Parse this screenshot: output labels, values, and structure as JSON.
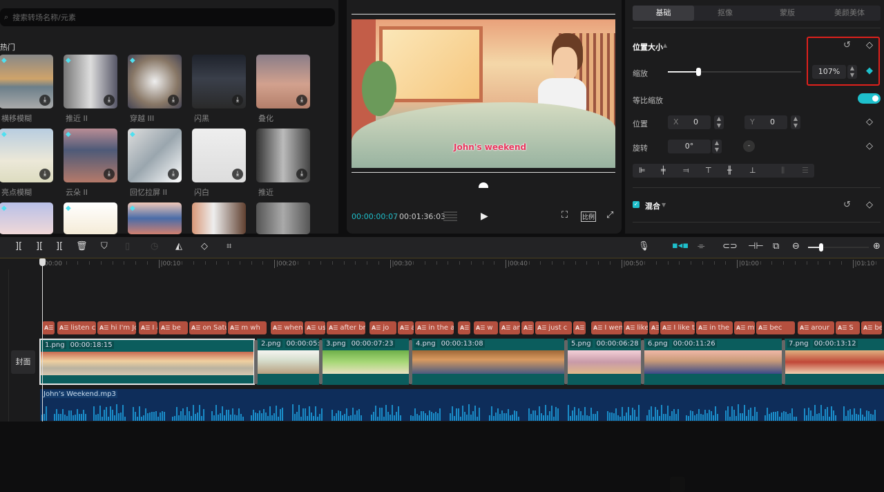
{
  "left_panel": {
    "search_placeholder": "搜索转场名称/元素",
    "section": "热门",
    "tiles": [
      "横移模糊",
      "推近 II",
      "穿越 III",
      "闪黑",
      "叠化",
      "亮点模糊",
      "云朵 II",
      "回忆拉屏 II",
      "闪白",
      "推近",
      "",
      "",
      "",
      "",
      ""
    ]
  },
  "preview": {
    "caption": "John's weekend",
    "current_time": "00:00:00:07",
    "separator": "/",
    "total_time": "00:01:36:03",
    "ratio_label": "比例"
  },
  "right_panel": {
    "tabs": [
      "基础",
      "抠像",
      "蒙版",
      "美颜美体"
    ],
    "active_tab": 0,
    "section_title": "位置大小",
    "scale_label": "缩放",
    "scale_value": "107%",
    "scale_percent": 107,
    "uniform_scale_label": "等比缩放",
    "uniform_scale_on": true,
    "position_label": "位置",
    "x_label": "X",
    "x_value": "0",
    "y_label": "Y",
    "y_value": "0",
    "rotation_label": "旋转",
    "rotation_value": "0°",
    "blend_label": "混合",
    "blend_checked": true,
    "accent": "#1ec0cc",
    "highlight_color": "#e0201c"
  },
  "timeline": {
    "ruler": [
      "00:00",
      "|00:10",
      "|00:20",
      "|00:30",
      "|00:40",
      "|00:50",
      "|01:00",
      "|01:10"
    ],
    "cover_label": "封面",
    "subtitles": [
      "",
      "listen c",
      "hi I'm Jo",
      "I a",
      "be",
      "on Satu",
      "m wh",
      "when I",
      "usu",
      "after br",
      "jo",
      "ar",
      "in the a",
      "",
      "w",
      "and",
      "",
      "just c",
      "",
      "I went",
      "like cl",
      "",
      "I like t",
      "in the",
      "my",
      "bec",
      "arour",
      "S",
      "bec"
    ],
    "subtitle_icon": "A☰",
    "clips": [
      {
        "name": "1.png",
        "duration": "00:00:18:15"
      },
      {
        "name": "2.png",
        "duration": "00:00:05:19"
      },
      {
        "name": "3.png",
        "duration": "00:00:07:23"
      },
      {
        "name": "4.png",
        "duration": "00:00:13:08"
      },
      {
        "name": "5.png",
        "duration": "00:00:06:28"
      },
      {
        "name": "6.png",
        "duration": "00:00:11:26"
      },
      {
        "name": "7.png",
        "duration": "00:00:13:12"
      }
    ],
    "audio_name": "John’s Weekend.mp3"
  }
}
